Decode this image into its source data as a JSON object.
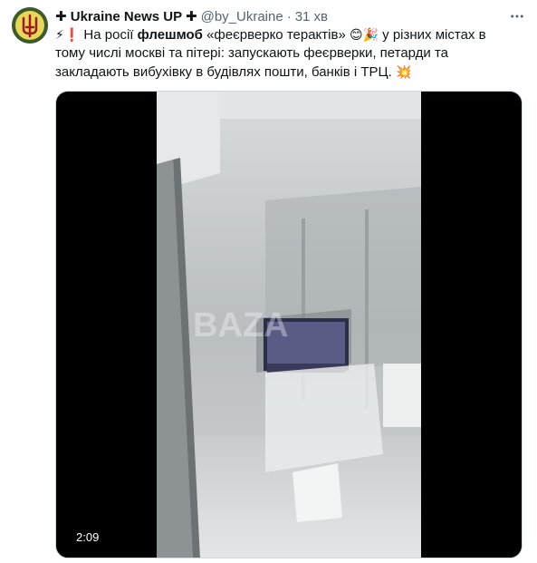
{
  "tweet": {
    "author": {
      "display_name": "✚ Ukraine News UP ✚",
      "handle": "@by_Ukraine",
      "separator": "·",
      "time": "31 хв"
    },
    "text": {
      "lead_emojis": "⚡❗",
      "part1": " На росії ",
      "bold": "флешмоб",
      "part2": " «феєрверко терактів» ",
      "mid_emojis": "😊🎉",
      "part3": " у різних містах в тому числі москві та пітері: запускають феєрверки, петарди та закладають вибухівку в будівлях пошти, банків і ТРЦ. ",
      "end_emoji": "💥"
    },
    "media": {
      "watermark": "BAZA",
      "duration": "2:09"
    },
    "more_icon": "more-horizontal-icon",
    "avatar_icon": "trident-icon"
  },
  "colors": {
    "text": "#0f1419",
    "secondary": "#536471",
    "avatar_bg": "#3d5a2a",
    "media_bg": "#000000"
  }
}
